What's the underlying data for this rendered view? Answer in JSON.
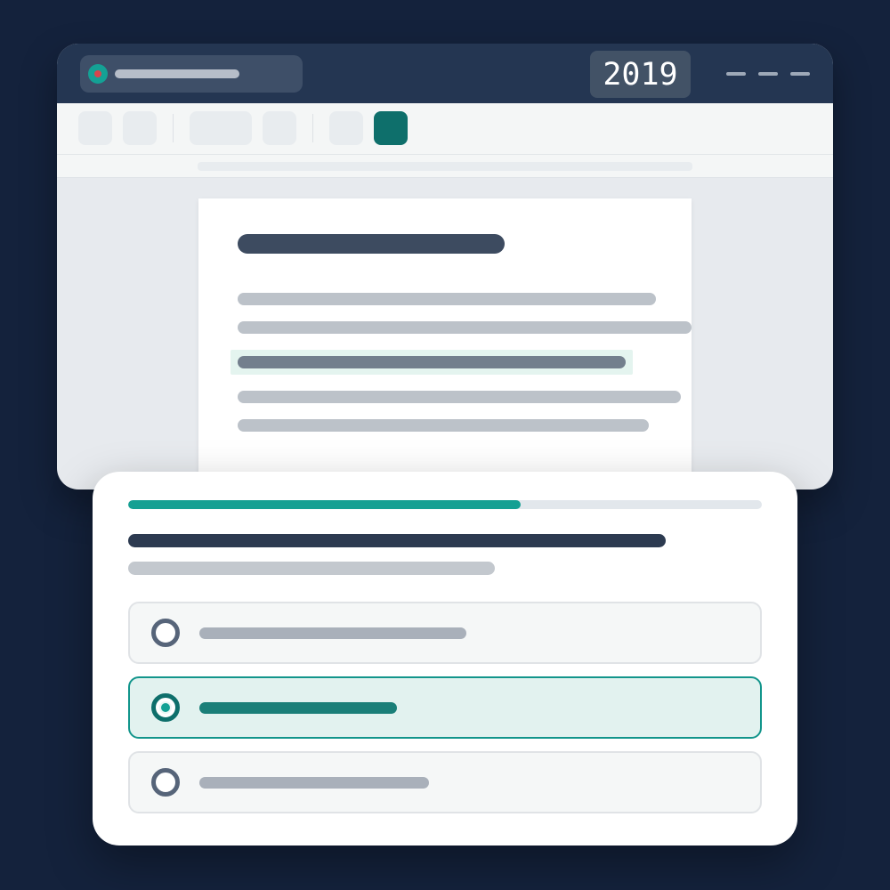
{
  "window": {
    "year": "2019"
  },
  "toolbar": {
    "buttons": [
      "tool",
      "tool",
      "tool",
      "tool",
      "tool",
      "active-tool"
    ]
  },
  "quiz": {
    "progress": 0.62,
    "selected_option": 2,
    "options": [
      {
        "index": 1,
        "selected": false
      },
      {
        "index": 2,
        "selected": true
      },
      {
        "index": 3,
        "selected": false
      }
    ]
  },
  "colors": {
    "background": "#14223c",
    "titlebar": "#243652",
    "accent": "#15a093",
    "accent_dark": "#0e6f6b",
    "selected_bg": "#e2f2ef"
  },
  "icons": {
    "site": "site-favicon-icon",
    "window_controls": "window-control-icon",
    "radio": "radio-button-icon"
  }
}
